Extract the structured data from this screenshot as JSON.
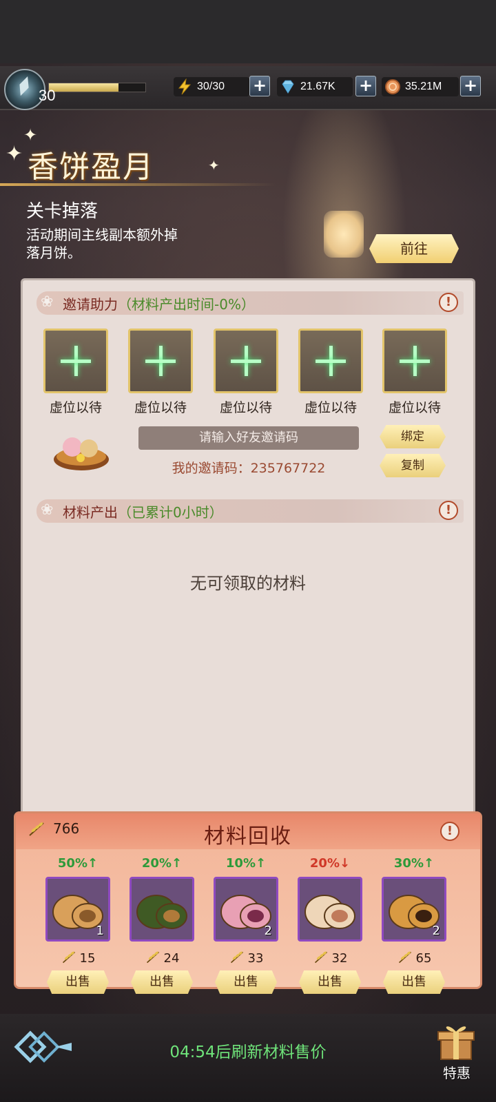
{
  "header": {
    "level": "30",
    "exp_fraction": 0.72,
    "energy": "30/30",
    "gems": "21.67K",
    "gold": "35.21M"
  },
  "event": {
    "title": "香饼盈月",
    "sub_title": "关卡掉落",
    "description": "活动期间主线副本额外掉落月饼。",
    "go_button": "前往"
  },
  "invite": {
    "section_title": "邀请助力",
    "section_note": "（材料产出时间-0%）",
    "slots": [
      "虚位以待",
      "虚位以待",
      "虚位以待",
      "虚位以待",
      "虚位以待"
    ],
    "input_placeholder": "请输入好友邀请码",
    "my_code": "我的邀请码：235767722",
    "bind_button": "绑定",
    "copy_button": "复制"
  },
  "output": {
    "section_title": "材料产出",
    "section_note": "（已累计0小时）",
    "empty_message": "无可领取的材料"
  },
  "recycle": {
    "title": "材料回收",
    "currency_count": "766",
    "sell_label": "出售",
    "items": [
      {
        "percent": "50%↑",
        "trend": "up",
        "count": "1",
        "price": "15",
        "name": "nut-mooncake"
      },
      {
        "percent": "20%↑",
        "trend": "up",
        "count": "",
        "price": "24",
        "name": "matcha-mooncake"
      },
      {
        "percent": "10%↑",
        "trend": "up",
        "count": "2",
        "price": "33",
        "name": "snowskin-mooncake"
      },
      {
        "percent": "20%↓",
        "trend": "down",
        "count": "",
        "price": "32",
        "name": "flaky-mooncake"
      },
      {
        "percent": "30%↑",
        "trend": "up",
        "count": "2",
        "price": "65",
        "name": "yolk-mooncake"
      }
    ]
  },
  "footer": {
    "refresh_text": "04:54后刷新材料售价",
    "gift_label": "特惠"
  },
  "colors": {
    "accent_gold": "#f1cf72",
    "panel_bg": "#e8ddd8",
    "up_green": "#2e9a3a",
    "down_red": "#d03828",
    "refresh_green": "#6fe47a"
  }
}
